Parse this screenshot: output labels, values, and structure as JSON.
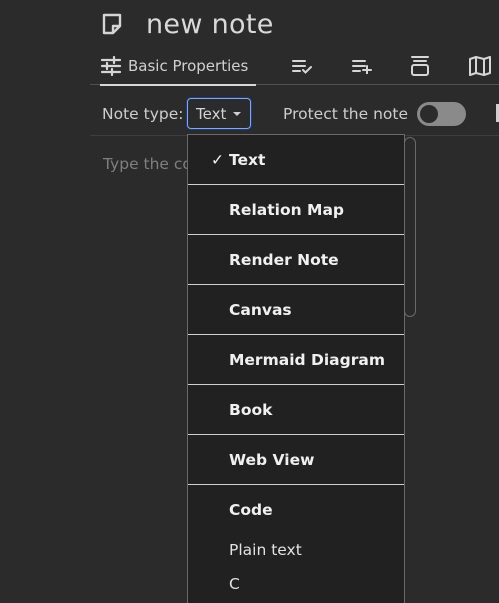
{
  "note": {
    "title": "new note",
    "icon": "note-icon"
  },
  "ribbon": {
    "active_tab_label": "Basic Properties",
    "tabs": [
      {
        "name": "basic-properties",
        "icon": "sliders-icon"
      },
      {
        "name": "note-info",
        "icon": "list-check-icon"
      },
      {
        "name": "promoted-attributes",
        "icon": "list-plus-icon"
      },
      {
        "name": "similar-notes",
        "icon": "stack-icon"
      },
      {
        "name": "note-map",
        "icon": "map-icon"
      }
    ]
  },
  "props": {
    "note_type_label": "Note type:",
    "note_type_value": "Text",
    "protect_label": "Protect the note",
    "protect_on": false
  },
  "editor": {
    "placeholder_visible": "Type the co"
  },
  "dropdown": {
    "check_mark": "✓",
    "items": [
      {
        "label": "Text",
        "selected": true
      },
      {
        "label": "Relation Map"
      },
      {
        "label": "Render Note"
      },
      {
        "label": "Canvas"
      },
      {
        "label": "Mermaid Diagram"
      },
      {
        "label": "Book"
      },
      {
        "label": "Web View"
      }
    ],
    "code_group": {
      "header": "Code",
      "items": [
        "Plain text",
        "C"
      ]
    }
  },
  "colors": {
    "background": "#2b2b2b",
    "dropdown_bg": "#212121",
    "focus_border": "#7aa7ff",
    "toggle_off": "#8a8a8a"
  }
}
